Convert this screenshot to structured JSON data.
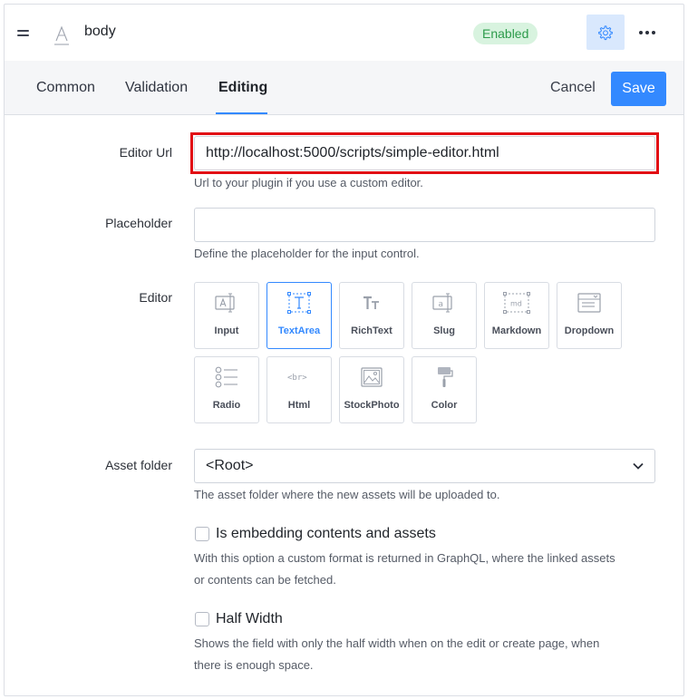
{
  "header": {
    "field_name": "body",
    "status": "Enabled",
    "type_icon": "text-field-icon",
    "settings_icon": "gear-icon",
    "more_icon": "more-horizontal-icon",
    "drag_icon": "drag-handle-icon"
  },
  "tabs": [
    {
      "label": "Common",
      "active": false
    },
    {
      "label": "Validation",
      "active": false
    },
    {
      "label": "Editing",
      "active": true
    }
  ],
  "actions": {
    "cancel": "Cancel",
    "save": "Save"
  },
  "form": {
    "editor_url": {
      "label": "Editor Url",
      "value": "http://localhost:5000/scripts/simple-editor.html",
      "hint": "Url to your plugin if you use a custom editor."
    },
    "placeholder": {
      "label": "Placeholder",
      "value": "",
      "hint": "Define the placeholder for the input control."
    },
    "editor": {
      "label": "Editor",
      "options": [
        {
          "label": "Input",
          "icon": "input-icon",
          "selected": false
        },
        {
          "label": "TextArea",
          "icon": "textarea-icon",
          "selected": true
        },
        {
          "label": "RichText",
          "icon": "richtext-icon",
          "selected": false
        },
        {
          "label": "Slug",
          "icon": "slug-icon",
          "selected": false
        },
        {
          "label": "Markdown",
          "icon": "markdown-icon",
          "selected": false
        },
        {
          "label": "Dropdown",
          "icon": "dropdown-icon",
          "selected": false
        },
        {
          "label": "Radio",
          "icon": "radio-icon",
          "selected": false
        },
        {
          "label": "Html",
          "icon": "html-icon",
          "selected": false
        },
        {
          "label": "StockPhoto",
          "icon": "stockphoto-icon",
          "selected": false
        },
        {
          "label": "Color",
          "icon": "color-icon",
          "selected": false
        }
      ]
    },
    "asset_folder": {
      "label": "Asset folder",
      "value": "<Root>",
      "hint": "The asset folder where the new assets will be uploaded to."
    },
    "embedding": {
      "label": "Is embedding contents and assets",
      "checked": false,
      "hint_line1": "With this option a custom format is returned in GraphQL, where the linked assets",
      "hint_line2": "or contents can be fetched."
    },
    "half_width": {
      "label": "Half Width",
      "checked": false,
      "hint_line1": "Shows the field with only the half width when on the edit or create page, when",
      "hint_line2": "there is enough space."
    }
  },
  "colors": {
    "accent": "#3389ff",
    "badge_bg": "#d8f3df",
    "badge_text": "#2d9b4b",
    "highlight": "#e10d14"
  }
}
